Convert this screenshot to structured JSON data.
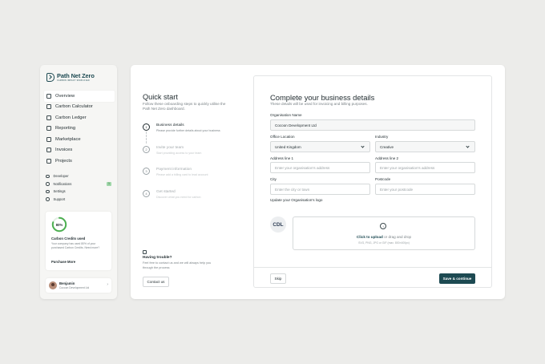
{
  "brand": {
    "name": "Path Net Zero",
    "tagline": "CARBON IMPACT SIMPLIFIED"
  },
  "sidebar": {
    "nav": [
      {
        "label": "Overview",
        "icon": "home-icon"
      },
      {
        "label": "Carbon Calculator",
        "icon": "calculator-icon"
      },
      {
        "label": "Carbon Ledger",
        "icon": "ledger-icon"
      },
      {
        "label": "Reporting",
        "icon": "chart-icon"
      },
      {
        "label": "Marketplace",
        "icon": "store-icon"
      },
      {
        "label": "Invoices",
        "icon": "invoice-icon"
      },
      {
        "label": "Projects",
        "icon": "projects-icon"
      }
    ],
    "secondary": [
      {
        "label": "Developer",
        "icon": "developer-icon"
      },
      {
        "label": "Notifications",
        "icon": "bell-icon",
        "badge": "1"
      },
      {
        "label": "Settings",
        "icon": "gear-icon"
      },
      {
        "label": "Support",
        "icon": "support-icon"
      }
    ],
    "credits": {
      "percent_label": "80%",
      "percent": 80,
      "title": "Carbon Credits used",
      "description": "Your company has used 80% of your purchased Carbon Credits. Need more?",
      "link": "Purchase More"
    },
    "user": {
      "name": "Benjamin",
      "org": "Cocoon Development Ltd"
    }
  },
  "quick_start": {
    "title": "Quick start",
    "description": "Follow these onboarding steps to quickly utilise the Path Net Zero dashboard.",
    "steps": [
      {
        "num": "1",
        "title": "Business details",
        "desc": "Please provide further details about your business"
      },
      {
        "num": "2",
        "title": "Invite your team",
        "desc": "Start providing access to your team"
      },
      {
        "num": "3",
        "title": "Payment information",
        "desc": "Please add a billing card to lead account"
      },
      {
        "num": "4",
        "title": "Get started",
        "desc": "Discover what you need for carbon"
      }
    ],
    "help": {
      "title": "Having trouble?",
      "description": "Feel free to contact us and we will always help you through the process",
      "button": "Contact us"
    }
  },
  "form": {
    "title": "Complete your business details",
    "description": "These details will be used for invoicing and billing purposes.",
    "org_name": {
      "label": "Organisation Name",
      "value": "Cocoon Development Ltd"
    },
    "office_location": {
      "label": "Office Location",
      "value": "United Kingdom"
    },
    "industry": {
      "label": "Industry",
      "value": "Creative"
    },
    "address1": {
      "label": "Address line 1",
      "placeholder": "Enter your organisation's address"
    },
    "address2": {
      "label": "Address line 2",
      "placeholder": "Enter your organisation's address"
    },
    "city": {
      "label": "City",
      "placeholder": "Enter the city or town"
    },
    "postcode": {
      "label": "Postcode",
      "placeholder": "Enter your postcode"
    },
    "logo": {
      "label": "Update your Organisation's logo",
      "initials": "CDL",
      "upload_link": "Click to upload",
      "upload_rest": " or drag and drop",
      "hint": "SVG, PNG, JPG or GIF (max. 800×400px)"
    },
    "skip": "Skip",
    "save": "Save & continue"
  },
  "colors": {
    "brand": "#1d4a52",
    "ring": "#4caf50"
  }
}
